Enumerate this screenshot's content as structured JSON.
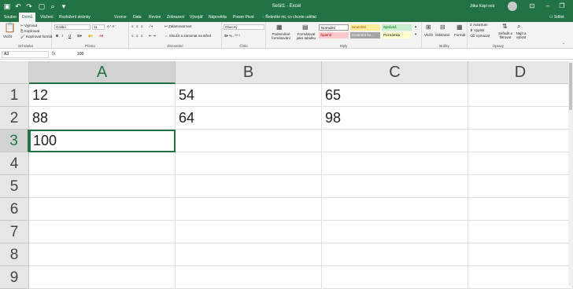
{
  "titlebar": {
    "title": "Sešit1 - Excel",
    "user": "Jitka Kápl ová",
    "minimize": "–",
    "restore": "❐",
    "close": "✕"
  },
  "tabs": [
    "Soubor",
    "Domů",
    "Vložení",
    "Rozložení stránky",
    "Vzorce",
    "Data",
    "Revize",
    "Zobrazení",
    "Vývojář",
    "Nápověda",
    "Power Pivot"
  ],
  "active_tab": "Domů",
  "tellme": "Řekněte mi, co chcete udělat",
  "share": "Sdílet",
  "ribbon": {
    "clipboard": {
      "paste": "Vložit",
      "cut": "Vyjmout",
      "copy": "Kopírovat",
      "format_painter": "Kopírovat formát",
      "label": "Schránka"
    },
    "font": {
      "name": "Calibri",
      "size": "11",
      "label": "Písmo",
      "bold": "B",
      "italic": "I",
      "underline": "U"
    },
    "alignment": {
      "wrap": "Zalamovat text",
      "merge": "Sloučit a zarovnat na střed",
      "label": "Zarovnání"
    },
    "number": {
      "format": "Obecný",
      "label": "Číslo"
    },
    "styles": {
      "conditional": "Podmíněné formátování",
      "as_table": "Formátovat jako tabulku",
      "cells": [
        {
          "text": "Normální",
          "bg": "#ffffff",
          "color": "#000000"
        },
        {
          "text": "Neutrální",
          "bg": "#ffeb9c",
          "color": "#9c5700"
        },
        {
          "text": "Správně",
          "bg": "#c6efce",
          "color": "#006100"
        },
        {
          "text": "Špatně",
          "bg": "#ffc7ce",
          "color": "#9c0006"
        },
        {
          "text": "Kontrolní bu...",
          "bg": "#a5a5a5",
          "color": "#ffffff"
        },
        {
          "text": "Poznámka",
          "bg": "#ffffcc",
          "color": "#000000"
        }
      ],
      "label": "Styly"
    },
    "cells_group": {
      "insert": "Vložit",
      "delete": "Odstranit",
      "format": "Formát",
      "label": "Buňky"
    },
    "editing": {
      "autosum": "AutoSum",
      "fill": "Vyplnit",
      "clear": "Vymazat",
      "sort": "Seřadit a filtrovat",
      "find": "Najít a vybrat",
      "label": "Úpravy"
    }
  },
  "formula_bar": {
    "name_box": "A3",
    "fx": "fx",
    "value": "100"
  },
  "sheet": {
    "columns": [
      "A",
      "B",
      "C",
      "D"
    ],
    "rows": [
      "1",
      "2",
      "3",
      "4",
      "5",
      "6",
      "7",
      "8",
      "9"
    ],
    "cells": {
      "A1": "12",
      "B1": "54",
      "C1": "65",
      "A2": "88",
      "B2": "64",
      "C2": "98",
      "A3": "100"
    },
    "selected": "A3"
  },
  "colors": {
    "accent": "#217346"
  }
}
